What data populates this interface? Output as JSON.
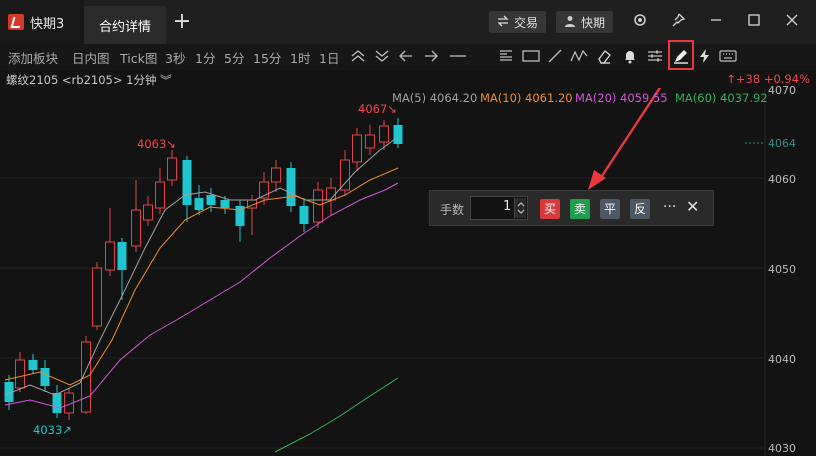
{
  "app": {
    "name": "快期3"
  },
  "tabs": {
    "active": "合约详情",
    "new_tab": "+"
  },
  "header": {
    "trade_label": "交易",
    "account_label": "快期",
    "icons": [
      "settings-gear-icon",
      "pin-icon",
      "minimize-icon",
      "maximize-icon",
      "close-icon"
    ]
  },
  "toolbar": {
    "add_plate": "添加板块",
    "intraday": "日内图",
    "tick": "Tick图",
    "periods": [
      "3秒",
      "1分",
      "5分",
      "15分",
      "1时",
      "1日"
    ],
    "tools": [
      "zoom-in-icon",
      "zoom-out-icon",
      "arrow-left-icon",
      "arrow-right-icon",
      "line-icon",
      "text-icon",
      "rectangle-icon",
      "segment-icon",
      "polyline-icon",
      "eraser-icon",
      "bell-icon",
      "settings-sliders-icon",
      "pen-icon",
      "lightning-icon",
      "keyboard-icon"
    ]
  },
  "info": {
    "contract": "螺纹2105 <rb2105> 1分钟 ︾",
    "change": "↑+38 +0.94%"
  },
  "ma": [
    {
      "label": "MA(5) 4064.20",
      "color": "#a0a0a0"
    },
    {
      "label": "MA(10) 4061.20",
      "color": "#f08a2c"
    },
    {
      "label": "MA(20) 4059.55",
      "color": "#d255d8"
    },
    {
      "label": "MA(60) 4037.92",
      "color": "#34b254"
    }
  ],
  "annotations": {
    "high_1": "4067↘",
    "high_2": "4063↘",
    "low": "4033↗"
  },
  "axis": {
    "p4070": "4070",
    "p4064": "4064",
    "p4060": "4060",
    "p4050": "4050",
    "p4040": "4040",
    "p4030": "4030"
  },
  "order": {
    "qty_label": "手数",
    "qty_value": "1",
    "buy": "买",
    "sell": "卖",
    "close_pos": "平",
    "reverse": "反",
    "more": "···",
    "close": "✕"
  },
  "colors": {
    "up": "#e0434a",
    "down": "#20c6cf",
    "highlight": "#e8393f",
    "bg": "#131313"
  }
}
